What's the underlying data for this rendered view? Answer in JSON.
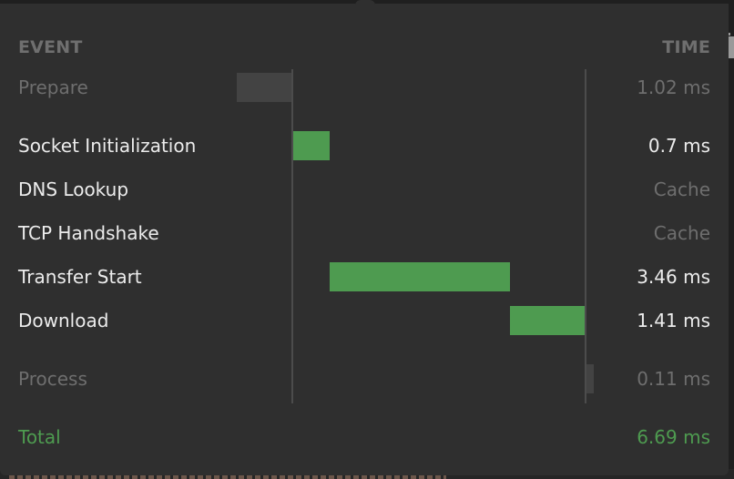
{
  "headers": {
    "event": "EVENT",
    "time": "TIME"
  },
  "rows": [
    {
      "label": "Prepare",
      "time": "1.02 ms",
      "style": "dim",
      "bar": "grey"
    },
    {
      "label": "Socket Initialization",
      "time": "0.7 ms",
      "style": "normal",
      "bar": "green"
    },
    {
      "label": "DNS Lookup",
      "time": "Cache",
      "style": "normal",
      "bar": "none"
    },
    {
      "label": "TCP Handshake",
      "time": "Cache",
      "style": "normal",
      "bar": "none"
    },
    {
      "label": "Transfer Start",
      "time": "3.46 ms",
      "style": "normal",
      "bar": "green"
    },
    {
      "label": "Download",
      "time": "1.41 ms",
      "style": "normal",
      "bar": "green"
    },
    {
      "label": "Process",
      "time": "0.11 ms",
      "style": "dim",
      "bar": "grey"
    }
  ],
  "total": {
    "label": "Total",
    "time": "6.69 ms"
  },
  "colors": {
    "bar_green": "#4e9b50",
    "bar_grey": "#434343",
    "total": "#4e9b50"
  }
}
